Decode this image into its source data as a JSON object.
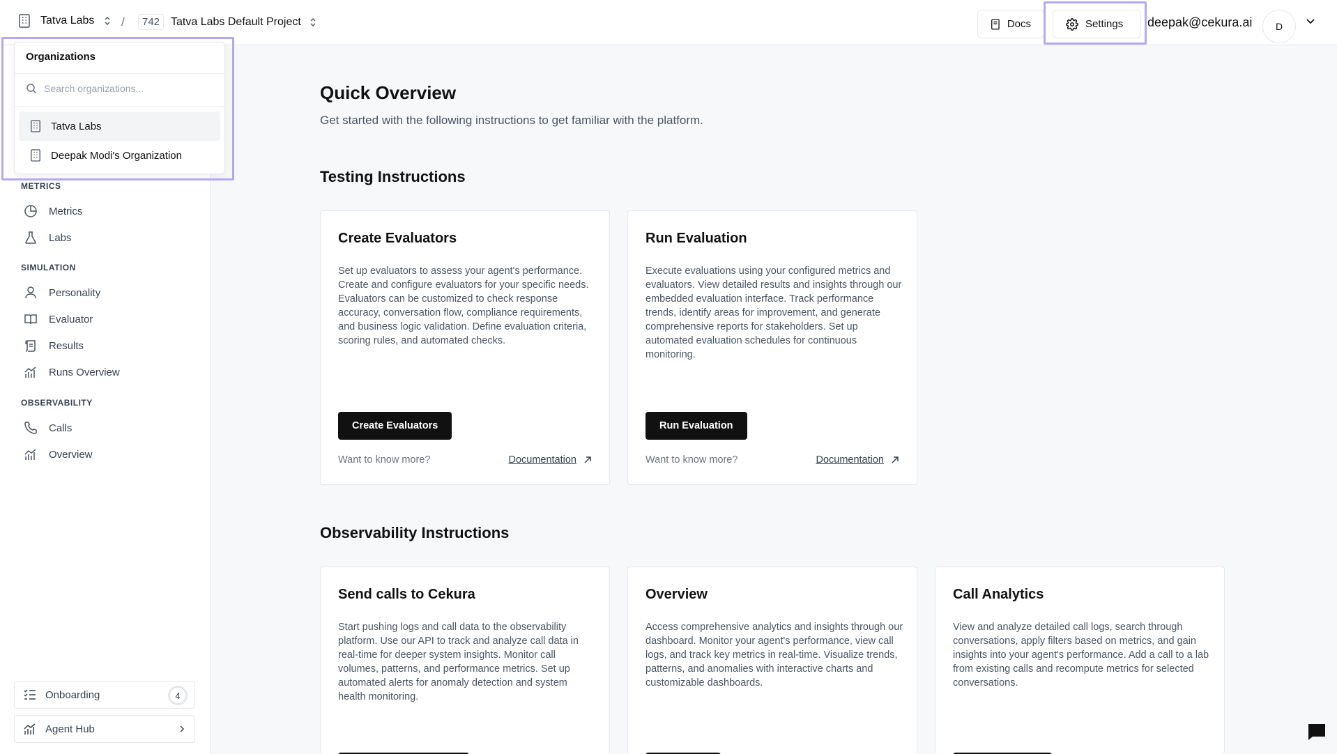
{
  "topbar": {
    "org_name": "Tatva Labs",
    "separator": "/",
    "project_number": "742",
    "project_name": "Tatva Labs Default Project",
    "docs_label": "Docs",
    "settings_label": "Settings",
    "user_email": "deepak@cekura.ai",
    "avatar_initial": "D"
  },
  "org_dropdown": {
    "title": "Organizations",
    "search_placeholder": "Search organizations...",
    "items": [
      {
        "label": "Tatva Labs",
        "active": true
      },
      {
        "label": "Deepak Modi's Organization",
        "active": false
      }
    ]
  },
  "sidebar": {
    "sections": [
      {
        "title": "METRICS",
        "items": [
          {
            "label": "Metrics",
            "icon": "pie-chart-icon"
          },
          {
            "label": "Labs",
            "icon": "flask-icon"
          }
        ]
      },
      {
        "title": "SIMULATION",
        "items": [
          {
            "label": "Personality",
            "icon": "user-icon"
          },
          {
            "label": "Evaluator",
            "icon": "book-icon"
          },
          {
            "label": "Results",
            "icon": "scroll-icon"
          },
          {
            "label": "Runs Overview",
            "icon": "bar-chart-icon"
          }
        ]
      },
      {
        "title": "OBSERVABILITY",
        "items": [
          {
            "label": "Calls",
            "icon": "phone-icon"
          },
          {
            "label": "Overview",
            "icon": "bar-chart-icon"
          }
        ]
      }
    ],
    "onboarding_label": "Onboarding",
    "onboarding_count": "4",
    "agent_hub_label": "Agent Hub"
  },
  "main": {
    "title": "Quick Overview",
    "subtitle": "Get started with the following instructions to get familiar with the platform.",
    "testing_title": "Testing Instructions",
    "testing_cards": [
      {
        "title": "Create Evaluators",
        "description": "Set up evaluators to assess your agent's performance. Create and configure evaluators for your specific needs. Evaluators can be customized to check response accuracy, conversation flow, compliance requirements, and business logic validation. Define evaluation criteria, scoring rules, and automated checks.",
        "button": "Create Evaluators",
        "want_more": "Want to know more?",
        "doc_link": "Documentation"
      },
      {
        "title": "Run Evaluation",
        "description": "Execute evaluations using your configured metrics and evaluators. View detailed results and insights through our embedded evaluation interface. Track performance trends, identify areas for improvement, and generate comprehensive reports for stakeholders. Set up automated evaluation schedules for continuous monitoring.",
        "button": "Run Evaluation",
        "want_more": "Want to know more?",
        "doc_link": "Documentation"
      }
    ],
    "observability_title": "Observability Instructions",
    "observability_cards": [
      {
        "title": "Send calls to Cekura",
        "description": "Start pushing logs and call data to the observability platform. Use our API to track and analyze call data in real-time for deeper system insights. Monitor call volumes, patterns, and performance metrics. Set up automated alerts for anomaly detection and system health monitoring."
      },
      {
        "title": "Overview",
        "description": "Access comprehensive analytics and insights through our dashboard. Monitor your agent's performance, view call logs, and track key metrics in real-time. Visualize trends, patterns, and anomalies with interactive charts and customizable dashboards."
      },
      {
        "title": "Call Analytics",
        "description": "View and analyze detailed call logs, search through conversations, apply filters based on metrics, and gain insights into your agent's performance. Add a call to a lab from existing calls and recompute metrics for selected conversations."
      }
    ]
  }
}
